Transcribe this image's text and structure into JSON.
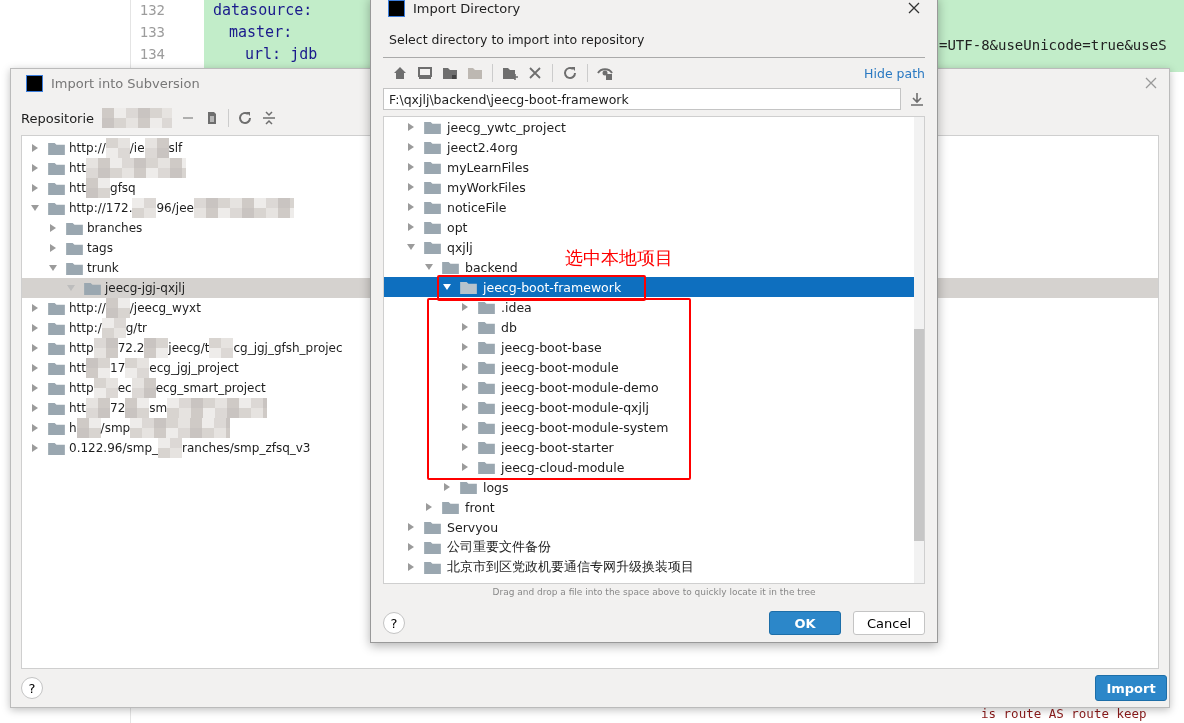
{
  "editor": {
    "lines": [
      {
        "number": "132",
        "code": "datasource:"
      },
      {
        "number": "133",
        "code": "master:"
      },
      {
        "number": "134",
        "code": "url: jdb"
      }
    ],
    "code_right": "=UTF-8&useUnicode=true&useS",
    "code_bottom": "is route AS route keep"
  },
  "svn_dialog": {
    "title": "Import into Subversion",
    "toolbar_label": "Repositorie",
    "tree": [
      {
        "parts": [
          "http://",
          "/ie",
          "slf"
        ],
        "blurred_end": false,
        "expanded": false,
        "selected": false
      },
      {
        "parts": [
          "htt"
        ],
        "blurred_end": true,
        "expanded": false,
        "selected": false
      },
      {
        "parts": [
          "htt",
          "gfsq"
        ],
        "blurred_end": false,
        "expanded": false,
        "selected": false
      },
      {
        "parts": [
          "http://172.",
          "96/jee"
        ],
        "blurred_end": true,
        "expanded": true,
        "selected": false,
        "children": [
          {
            "parts": [
              "branches"
            ],
            "blurred_end": false,
            "expanded": false,
            "selected": false
          },
          {
            "parts": [
              "tags"
            ],
            "blurred_end": false,
            "expanded": false,
            "selected": false
          },
          {
            "parts": [
              "trunk"
            ],
            "blurred_end": false,
            "expanded": true,
            "selected": false,
            "children": [
              {
                "parts": [
                  "jeecg-jgj-qxjlj"
                ],
                "blurred_end": false,
                "expanded": true,
                "selected": true
              }
            ]
          }
        ]
      },
      {
        "parts": [
          "http://",
          "/jeecg_wyxt"
        ],
        "blurred_end": false,
        "expanded": false,
        "selected": false
      },
      {
        "parts": [
          "http:/",
          "g/tr"
        ],
        "blurred_end": false,
        "expanded": false,
        "selected": false
      },
      {
        "parts": [
          "http",
          "72.2",
          "jeecg/t",
          "cg_jgj_gfsh_projec"
        ],
        "blurred_end": false,
        "expanded": false,
        "selected": false
      },
      {
        "parts": [
          "htt",
          "17",
          "ecg_jgj_project"
        ],
        "blurred_end": false,
        "expanded": false,
        "selected": false
      },
      {
        "parts": [
          "http",
          "ec",
          "ecg_smart_project"
        ],
        "blurred_end": false,
        "expanded": false,
        "selected": false
      },
      {
        "parts": [
          "htt",
          "72",
          "sm"
        ],
        "blurred_end": true,
        "expanded": false,
        "selected": false
      },
      {
        "parts": [
          "h",
          "/smp"
        ],
        "blurred_end": true,
        "expanded": false,
        "selected": false
      },
      {
        "parts": [
          "0.122.96/smp_",
          "ranches/smp_zfsq_v3"
        ],
        "blurred_end": false,
        "expanded": false,
        "selected": false
      }
    ],
    "help": "?",
    "import_button": "Import"
  },
  "import_dialog": {
    "title": "Import Directory",
    "subtitle": "Select directory to import into repository",
    "hide_path": "Hide path",
    "path": "F:\\qxjlj\\backend\\jeecg-boot-framework",
    "tree": [
      {
        "label": "jeecg_ywtc_project",
        "expanded": false,
        "selected": false
      },
      {
        "label": "jeect2.4org",
        "expanded": false,
        "selected": false
      },
      {
        "label": "myLearnFiles",
        "expanded": false,
        "selected": false
      },
      {
        "label": "myWorkFiles",
        "expanded": false,
        "selected": false
      },
      {
        "label": "noticeFile",
        "expanded": false,
        "selected": false
      },
      {
        "label": "opt",
        "expanded": false,
        "selected": false
      },
      {
        "label": "qxjlj",
        "expanded": true,
        "selected": false,
        "children": [
          {
            "label": "backend",
            "expanded": true,
            "selected": false,
            "children": [
              {
                "label": "jeecg-boot-framework",
                "expanded": true,
                "selected": true,
                "children": [
                  {
                    "label": ".idea",
                    "expanded": false,
                    "selected": false
                  },
                  {
                    "label": "db",
                    "expanded": false,
                    "selected": false
                  },
                  {
                    "label": "jeecg-boot-base",
                    "expanded": false,
                    "selected": false
                  },
                  {
                    "label": "jeecg-boot-module",
                    "expanded": false,
                    "selected": false
                  },
                  {
                    "label": "jeecg-boot-module-demo",
                    "expanded": false,
                    "selected": false
                  },
                  {
                    "label": "jeecg-boot-module-qxjlj",
                    "expanded": false,
                    "selected": false
                  },
                  {
                    "label": "jeecg-boot-module-system",
                    "expanded": false,
                    "selected": false
                  },
                  {
                    "label": "jeecg-boot-starter",
                    "expanded": false,
                    "selected": false
                  },
                  {
                    "label": "jeecg-cloud-module",
                    "expanded": false,
                    "selected": false
                  }
                ]
              },
              {
                "label": "logs",
                "expanded": false,
                "selected": false
              }
            ]
          },
          {
            "label": "front",
            "expanded": false,
            "selected": false
          }
        ]
      },
      {
        "label": "Servyou",
        "expanded": false,
        "selected": false
      },
      {
        "label": "公司重要文件备份",
        "expanded": false,
        "selected": false
      },
      {
        "label": "北京市到区党政机要通信专网升级换装项目",
        "expanded": false,
        "selected": false
      }
    ],
    "annotation": "选中本地项目",
    "hint": "Drag and drop a file into the space above to quickly locate it in the tree",
    "help": "?",
    "ok": "OK",
    "cancel": "Cancel"
  }
}
